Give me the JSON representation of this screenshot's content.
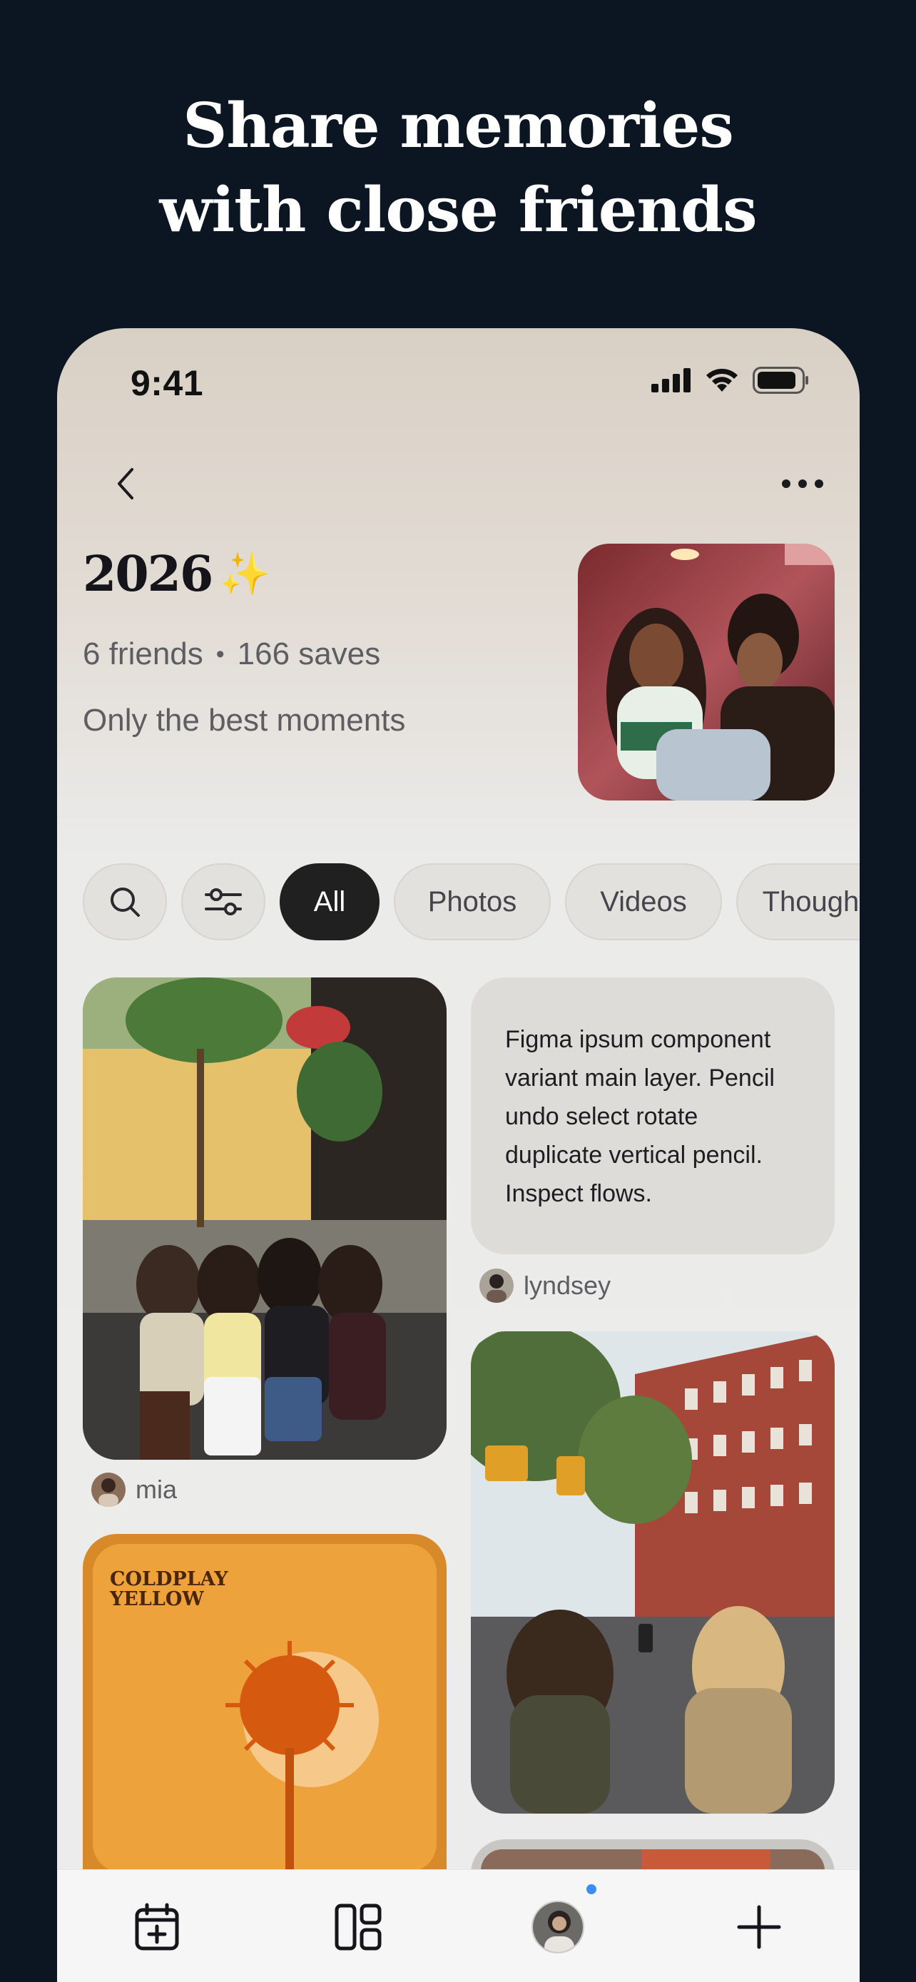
{
  "hero": {
    "line1": "Share memories",
    "line2": "with close friends"
  },
  "status_bar": {
    "time": "9:41"
  },
  "album": {
    "title": "2026",
    "emoji": "✨",
    "friends": "6 friends",
    "separator": "•",
    "saves": "166 saves",
    "description": "Only the best moments"
  },
  "filters": {
    "search_icon": "search-icon",
    "settings_icon": "sliders-icon",
    "items": [
      "All",
      "Photos",
      "Videos",
      "Thoughts"
    ],
    "active": "All"
  },
  "feed": {
    "note_text": "Figma ipsum component variant main layer. Pencil undo select rotate duplicate vertical pencil. Inspect flows.",
    "note_author": "lyndsey",
    "photo_author": "mia",
    "album_art_title_line1": "COLDPLAY",
    "album_art_title_line2": "YELLOW"
  },
  "tabbar": {
    "items": [
      "calendar-add-icon",
      "grid-layout-icon",
      "profile-avatar",
      "add-icon"
    ]
  },
  "colors": {
    "background": "#0b1622",
    "accent_dot": "#3a8ef6",
    "chip_active": "#202020"
  }
}
